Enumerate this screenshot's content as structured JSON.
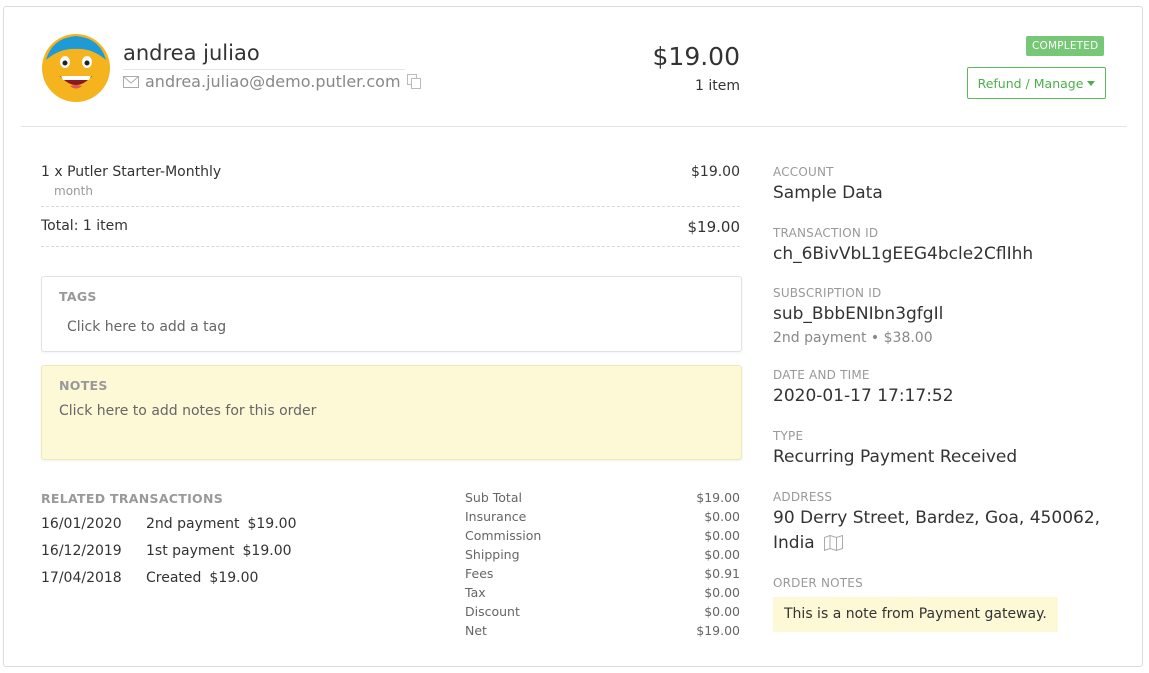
{
  "customer": {
    "name": "andrea juliao",
    "email": "andrea.juliao@demo.putler.com"
  },
  "order": {
    "amount": "$19.00",
    "item_count": "1 item",
    "status": "COMPLETED",
    "manage_label": "Refund / Manage"
  },
  "line_items": [
    {
      "name": "1 x Putler Starter-Monthly",
      "sub": "month",
      "price": "$19.00"
    }
  ],
  "total": {
    "label": "Total: 1 item",
    "value": "$19.00"
  },
  "tags": {
    "title": "TAGS",
    "placeholder": "Click here to add a tag"
  },
  "notes": {
    "title": "NOTES",
    "placeholder": "Click here to add notes for this order"
  },
  "related": {
    "title": "RELATED TRANSACTIONS",
    "rows": [
      {
        "date": "16/01/2020",
        "desc": "2nd payment",
        "amount": "$19.00"
      },
      {
        "date": "16/12/2019",
        "desc": "1st payment",
        "amount": "$19.00"
      },
      {
        "date": "17/04/2018",
        "desc": "Created",
        "amount": "$19.00"
      }
    ]
  },
  "summary": [
    {
      "label": "Sub Total",
      "value": "$19.00"
    },
    {
      "label": "Insurance",
      "value": "$0.00"
    },
    {
      "label": "Commission",
      "value": "$0.00"
    },
    {
      "label": "Shipping",
      "value": "$0.00"
    },
    {
      "label": "Fees",
      "value": "$0.91"
    },
    {
      "label": "Tax",
      "value": "$0.00"
    },
    {
      "label": "Discount",
      "value": "$0.00"
    },
    {
      "label": "Net",
      "value": "$19.00"
    }
  ],
  "details": {
    "account_label": "ACCOUNT",
    "account_value": "Sample Data",
    "transaction_label": "TRANSACTION ID",
    "transaction_value": "ch_6BivVbL1gEEG4bcle2CflIhh",
    "subscription_label": "SUBSCRIPTION ID",
    "subscription_value": "sub_BbbENIbn3gfgIl",
    "subscription_sub": "2nd payment • $38.00",
    "datetime_label": "DATE AND TIME",
    "datetime_value": "2020-01-17 17:17:52",
    "type_label": "TYPE",
    "type_value": "Recurring Payment Received",
    "address_label": "ADDRESS",
    "address_line1": "90 Derry Street, Bardez, Goa, 450062,",
    "address_line2": "India",
    "order_notes_label": "ORDER NOTES",
    "order_notes_value": "This is a note from Payment gateway."
  },
  "colors": {
    "status_green": "#76c776",
    "button_green": "#5cb85c",
    "note_yellow": "#fdf8d6",
    "avatar_yellow": "#f5b41e",
    "avatar_hair": "#1e9ad6"
  },
  "icons": {
    "email": "envelope-icon",
    "copy": "copy-icon",
    "dropdown": "caret-down-icon",
    "map": "map-icon"
  }
}
